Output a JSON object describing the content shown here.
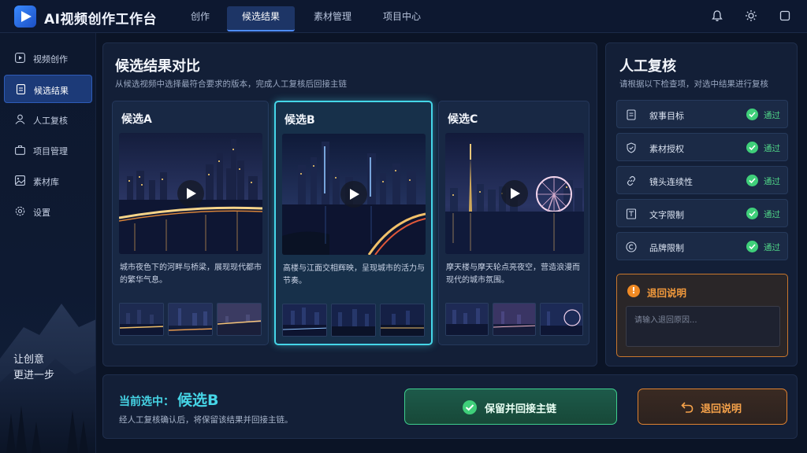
{
  "app": {
    "title": "AI视频创作工作台"
  },
  "nav": {
    "tabs": [
      {
        "label": "创作"
      },
      {
        "label": "候选结果"
      },
      {
        "label": "素材管理"
      },
      {
        "label": "项目中心"
      }
    ],
    "active_index": 1
  },
  "sidebar": {
    "items": [
      {
        "label": "视频创作",
        "icon": "play-square-icon"
      },
      {
        "label": "候选结果",
        "icon": "document-icon"
      },
      {
        "label": "人工复核",
        "icon": "user-icon"
      },
      {
        "label": "项目管理",
        "icon": "briefcase-icon"
      },
      {
        "label": "素材库",
        "icon": "image-icon"
      },
      {
        "label": "设置",
        "icon": "gear-icon"
      }
    ],
    "active_index": 1,
    "slogan_line1": "让创意",
    "slogan_line2": "更进一步"
  },
  "compare": {
    "title": "候选结果对比",
    "subtitle": "从候选视频中选择最符合要求的版本，完成人工复核后回接主链",
    "candidates": [
      {
        "title": "候选A",
        "description": "城市夜色下的河畔与桥梁，展现现代都市的繁华气息。",
        "selected": false
      },
      {
        "title": "候选B",
        "description": "高楼与江面交相辉映，呈现城市的活力与节奏。",
        "selected": true
      },
      {
        "title": "候选C",
        "description": "摩天楼与摩天轮点亮夜空，营造浪漫而现代的城市氛围。",
        "selected": false
      }
    ]
  },
  "review": {
    "title": "人工复核",
    "subtitle": "请根据以下检查项，对选中结果进行复核",
    "items": [
      {
        "label": "叙事目标",
        "status": "通过",
        "icon": "document-icon"
      },
      {
        "label": "素材授权",
        "status": "通过",
        "icon": "shield-icon"
      },
      {
        "label": "镜头连续性",
        "status": "通过",
        "icon": "link-icon"
      },
      {
        "label": "文字限制",
        "status": "通过",
        "icon": "text-box-icon"
      },
      {
        "label": "品牌限制",
        "status": "通过",
        "icon": "copyright-icon"
      }
    ],
    "return_note": {
      "title": "退回说明",
      "placeholder": "请输入退回原因..."
    }
  },
  "bottom": {
    "current_label": "当前选中：",
    "current_value": "候选B",
    "hint": "经人工复核确认后，将保留该结果并回接主链。",
    "keep_button": "保留并回接主链",
    "return_button": "退回说明"
  },
  "colors": {
    "accent": "#4e8dff",
    "selected_border": "#45d6e8",
    "pass_green": "#3fcf7a",
    "warn_orange": "#f08a24"
  }
}
